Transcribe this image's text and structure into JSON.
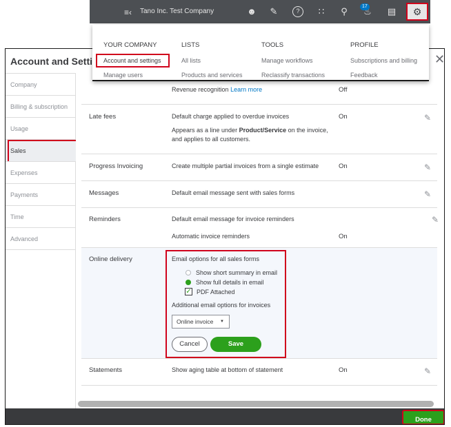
{
  "topbar": {
    "company_name": "Tano Inc. Test Company",
    "notification_count": "17",
    "icons": [
      "menu-icon",
      "user-icon",
      "megaphone-icon",
      "help-icon",
      "apps-icon",
      "search-icon",
      "bell-icon",
      "clipboard-icon",
      "gear-icon"
    ]
  },
  "gear_menu": {
    "columns": [
      {
        "heading": "YOUR COMPANY",
        "items": [
          "Account and settings",
          "Manage users"
        ]
      },
      {
        "heading": "LISTS",
        "items": [
          "All lists",
          "Products and services"
        ]
      },
      {
        "heading": "TOOLS",
        "items": [
          "Manage workflows",
          "Reclassify transactions"
        ]
      },
      {
        "heading": "PROFILE",
        "items": [
          "Subscriptions and billing",
          "Feedback"
        ]
      }
    ]
  },
  "panel": {
    "title": "Account and Setti",
    "sidebar": [
      "Company",
      "Billing & subscription",
      "Usage",
      "Sales",
      "Expenses",
      "Payments",
      "Time",
      "Advanced"
    ],
    "active_item": "Sales"
  },
  "sections": {
    "revenue": {
      "text": "Revenue recognition ",
      "link": "Learn more",
      "value": "Off"
    },
    "late_fees": {
      "label": "Late fees",
      "text1": "Default charge applied to overdue invoices",
      "text2a": "Appears as a line under ",
      "text2b": "Product/Service",
      "text2c": " on the invoice,",
      "text3": "and applies to all customers.",
      "value": "On"
    },
    "progress": {
      "label": "Progress Invoicing",
      "text": "Create multiple partial invoices from a single estimate",
      "value": "On"
    },
    "messages": {
      "label": "Messages",
      "text": "Default email message sent with sales forms"
    },
    "reminders": {
      "label": "Reminders",
      "text1": "Default email message for invoice reminders",
      "text2": "Automatic invoice reminders",
      "value": "On"
    },
    "online_delivery": {
      "label": "Online delivery",
      "email_options": "Email options for all sales forms",
      "opt_short": "Show short summary in email",
      "opt_full": "Show full details in email",
      "opt_pdf": "PDF Attached",
      "additional": "Additional email options for invoices",
      "select_value": "Online invoice",
      "cancel": "Cancel",
      "save": "Save"
    },
    "statements": {
      "label": "Statements",
      "text": "Show aging table at bottom of statement",
      "value": "On"
    }
  },
  "footer": {
    "done": "Done"
  },
  "colors": {
    "accent_green": "#2ca01c",
    "highlight_red": "#d0021b",
    "link_blue": "#0077c5",
    "topbar": "#4c4f53"
  }
}
